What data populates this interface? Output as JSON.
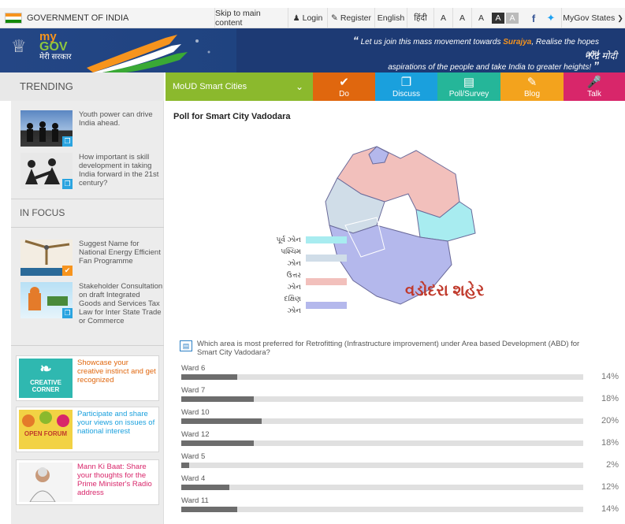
{
  "topbar": {
    "gov": "GOVERNMENT OF INDIA",
    "skip": "Skip to main content",
    "login": "Login",
    "register": "Register",
    "english": "English",
    "hindi": "हिंदी",
    "font_a1": "A",
    "font_a2": "A",
    "font_a3": "A",
    "contrast1": "A",
    "contrast2": "A",
    "states": "MyGov States"
  },
  "banner": {
    "logo_my": "my",
    "logo_gov": "GOV",
    "logo_hindi": "मेरी सरकार",
    "quote_line1_pre": "Let us join this mass movement towards ",
    "quote_emphasis": "Surajya",
    "quote_line1_post": ", Realise the hopes and",
    "quote_line2": "aspirations of the people and take India to greater heights!",
    "signature": "नरेंद्र मोदी"
  },
  "nav": {
    "trending": "TRENDING",
    "dropdown": "MoUD Smart Cities",
    "do": "Do",
    "discuss": "Discuss",
    "poll": "Poll/Survey",
    "blog": "Blog",
    "talk": "Talk",
    "colors": {
      "dropdown": "#8bb92d",
      "do": "#e0670e",
      "discuss": "#1aa0dd",
      "poll": "#25b699",
      "blog": "#f3a31d",
      "talk": "#d8266a"
    }
  },
  "sidebar": {
    "trending": [
      {
        "text": "Youth power can drive India ahead."
      },
      {
        "text": "How important is skill development in taking India forward in the 21st century?"
      }
    ],
    "infocus_title": "IN FOCUS",
    "infocus": [
      {
        "text": "Suggest Name for National Energy Efficient Fan Programme"
      },
      {
        "text": "Stakeholder Consultation on draft Integrated Goods and Services Tax Law for Inter State Trade or Commerce"
      }
    ],
    "cards": [
      {
        "img": "CREATIVE CORNER",
        "text": "Showcase your creative instinct and get recognized",
        "color": "#e0670e"
      },
      {
        "img": "OPEN FORUM",
        "text": "Participate and share your views on issues of national interest",
        "color": "#1aa0dd"
      },
      {
        "img": "",
        "text": "Mann Ki Baat: Share your thoughts for the Prime Minister's Radio address",
        "color": "#d8266a"
      }
    ]
  },
  "main": {
    "title": "Poll for Smart City Vadodara",
    "map": {
      "title": "વડોદરા શહેર",
      "legend": [
        {
          "label": "પૂર્વ ઝોન",
          "color": "#a8ecf0"
        },
        {
          "label": "પશ્ચિમ ઝોન",
          "color": "#d0dde8"
        },
        {
          "label": "ઉત્તર ઝોન",
          "color": "#f2c0bc"
        },
        {
          "label": "દક્ષિણ ઝોન",
          "color": "#b4b8ec"
        }
      ]
    },
    "question": "Which area is most preferred for Retrofitting (Infrastructure improvement) under Area based Development (ABD) for Smart City Vadodara?",
    "results": [
      {
        "label": "Ward 6",
        "percent_text": "14%",
        "value": 14
      },
      {
        "label": "Ward 7",
        "percent_text": "18%",
        "value": 18
      },
      {
        "label": "Ward 10",
        "percent_text": "20%",
        "value": 20
      },
      {
        "label": "Ward 12",
        "percent_text": "18%",
        "value": 18
      },
      {
        "label": "Ward 5",
        "percent_text": "2%",
        "value": 2
      },
      {
        "label": "Ward 4",
        "percent_text": "12%",
        "value": 12
      },
      {
        "label": "Ward 11",
        "percent_text": "14%",
        "value": 14
      }
    ]
  }
}
